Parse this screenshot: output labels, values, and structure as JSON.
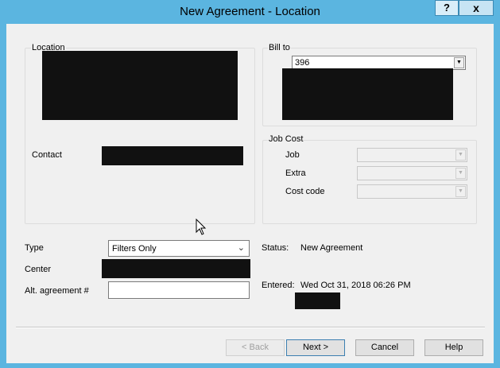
{
  "window": {
    "title": "New Agreement - Location",
    "help_button": "?",
    "close_button": "x"
  },
  "location_group": {
    "label": "Location",
    "contact_label": "Contact"
  },
  "bill_to_group": {
    "label": "Bill to",
    "value": "396"
  },
  "job_cost_group": {
    "label": "Job Cost",
    "job_label": "Job",
    "extra_label": "Extra",
    "cost_code_label": "Cost code"
  },
  "form": {
    "type_label": "Type",
    "type_value": "Filters Only",
    "center_label": "Center",
    "alt_agreement_label": "Alt. agreement #",
    "alt_agreement_value": ""
  },
  "status": {
    "status_label": "Status:",
    "status_value": "New Agreement",
    "entered_label": "Entered:",
    "entered_value": "Wed Oct 31, 2018 06:26 PM"
  },
  "buttons": {
    "back": "< Back",
    "next": "Next >",
    "cancel": "Cancel",
    "help": "Help"
  },
  "icons": {
    "dropdown": "dropdown-arrow-icon",
    "cursor": "mouse-pointer-icon"
  }
}
